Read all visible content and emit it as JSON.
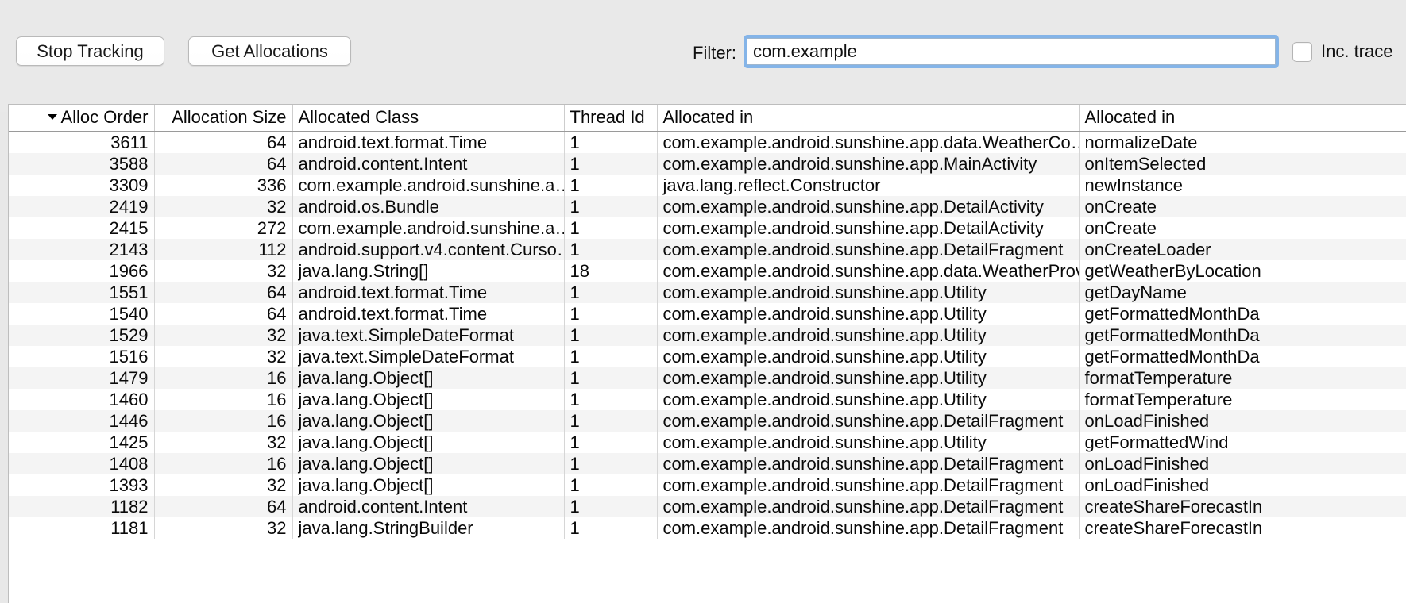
{
  "toolbar": {
    "stop_tracking_label": "Stop Tracking",
    "get_allocations_label": "Get Allocations",
    "filter_label": "Filter:",
    "filter_value": "com.example",
    "filter_placeholder": "",
    "inc_trace_label": "Inc. trace",
    "inc_trace_checked": false
  },
  "colors": {
    "focus_ring": "#84b4e8",
    "window_bg": "#e9e9e9",
    "row_alt": "#f4f4f4",
    "grid_line": "#d6d6d6"
  },
  "table": {
    "sort_column": "Alloc Order",
    "sort_direction": "descending",
    "columns": [
      {
        "key": "alloc_order",
        "label": "Alloc Order",
        "align": "right"
      },
      {
        "key": "allocation_size",
        "label": "Allocation Size",
        "align": "right"
      },
      {
        "key": "allocated_class",
        "label": "Allocated Class",
        "align": "left"
      },
      {
        "key": "thread_id",
        "label": "Thread Id",
        "align": "left"
      },
      {
        "key": "allocated_in_class",
        "label": "Allocated in",
        "align": "left"
      },
      {
        "key": "allocated_in_method",
        "label": "Allocated in",
        "align": "left"
      }
    ],
    "rows": [
      {
        "alloc_order": "3611",
        "allocation_size": "64",
        "allocated_class": "android.text.format.Time",
        "thread_id": "1",
        "allocated_in_class": "com.example.android.sunshine.app.data.WeatherCo…",
        "allocated_in_method": "normalizeDate"
      },
      {
        "alloc_order": "3588",
        "allocation_size": "64",
        "allocated_class": "android.content.Intent",
        "thread_id": "1",
        "allocated_in_class": "com.example.android.sunshine.app.MainActivity",
        "allocated_in_method": "onItemSelected"
      },
      {
        "alloc_order": "3309",
        "allocation_size": "336",
        "allocated_class": "com.example.android.sunshine.a…",
        "thread_id": "1",
        "allocated_in_class": "java.lang.reflect.Constructor",
        "allocated_in_method": "newInstance"
      },
      {
        "alloc_order": "2419",
        "allocation_size": "32",
        "allocated_class": "android.os.Bundle",
        "thread_id": "1",
        "allocated_in_class": "com.example.android.sunshine.app.DetailActivity",
        "allocated_in_method": "onCreate"
      },
      {
        "alloc_order": "2415",
        "allocation_size": "272",
        "allocated_class": "com.example.android.sunshine.a…",
        "thread_id": "1",
        "allocated_in_class": "com.example.android.sunshine.app.DetailActivity",
        "allocated_in_method": "onCreate"
      },
      {
        "alloc_order": "2143",
        "allocation_size": "112",
        "allocated_class": "android.support.v4.content.Curso…",
        "thread_id": "1",
        "allocated_in_class": "com.example.android.sunshine.app.DetailFragment",
        "allocated_in_method": "onCreateLoader"
      },
      {
        "alloc_order": "1966",
        "allocation_size": "32",
        "allocated_class": "java.lang.String[]",
        "thread_id": "18",
        "allocated_in_class": "com.example.android.sunshine.app.data.WeatherProvider",
        "allocated_in_method": "getWeatherByLocation"
      },
      {
        "alloc_order": "1551",
        "allocation_size": "64",
        "allocated_class": "android.text.format.Time",
        "thread_id": "1",
        "allocated_in_class": "com.example.android.sunshine.app.Utility",
        "allocated_in_method": "getDayName"
      },
      {
        "alloc_order": "1540",
        "allocation_size": "64",
        "allocated_class": "android.text.format.Time",
        "thread_id": "1",
        "allocated_in_class": "com.example.android.sunshine.app.Utility",
        "allocated_in_method": "getFormattedMonthDa"
      },
      {
        "alloc_order": "1529",
        "allocation_size": "32",
        "allocated_class": "java.text.SimpleDateFormat",
        "thread_id": "1",
        "allocated_in_class": "com.example.android.sunshine.app.Utility",
        "allocated_in_method": "getFormattedMonthDa"
      },
      {
        "alloc_order": "1516",
        "allocation_size": "32",
        "allocated_class": "java.text.SimpleDateFormat",
        "thread_id": "1",
        "allocated_in_class": "com.example.android.sunshine.app.Utility",
        "allocated_in_method": "getFormattedMonthDa"
      },
      {
        "alloc_order": "1479",
        "allocation_size": "16",
        "allocated_class": "java.lang.Object[]",
        "thread_id": "1",
        "allocated_in_class": "com.example.android.sunshine.app.Utility",
        "allocated_in_method": "formatTemperature"
      },
      {
        "alloc_order": "1460",
        "allocation_size": "16",
        "allocated_class": "java.lang.Object[]",
        "thread_id": "1",
        "allocated_in_class": "com.example.android.sunshine.app.Utility",
        "allocated_in_method": "formatTemperature"
      },
      {
        "alloc_order": "1446",
        "allocation_size": "16",
        "allocated_class": "java.lang.Object[]",
        "thread_id": "1",
        "allocated_in_class": "com.example.android.sunshine.app.DetailFragment",
        "allocated_in_method": "onLoadFinished"
      },
      {
        "alloc_order": "1425",
        "allocation_size": "32",
        "allocated_class": "java.lang.Object[]",
        "thread_id": "1",
        "allocated_in_class": "com.example.android.sunshine.app.Utility",
        "allocated_in_method": "getFormattedWind"
      },
      {
        "alloc_order": "1408",
        "allocation_size": "16",
        "allocated_class": "java.lang.Object[]",
        "thread_id": "1",
        "allocated_in_class": "com.example.android.sunshine.app.DetailFragment",
        "allocated_in_method": "onLoadFinished"
      },
      {
        "alloc_order": "1393",
        "allocation_size": "32",
        "allocated_class": "java.lang.Object[]",
        "thread_id": "1",
        "allocated_in_class": "com.example.android.sunshine.app.DetailFragment",
        "allocated_in_method": "onLoadFinished"
      },
      {
        "alloc_order": "1182",
        "allocation_size": "64",
        "allocated_class": "android.content.Intent",
        "thread_id": "1",
        "allocated_in_class": "com.example.android.sunshine.app.DetailFragment",
        "allocated_in_method": "createShareForecastIn"
      },
      {
        "alloc_order": "1181",
        "allocation_size": "32",
        "allocated_class": "java.lang.StringBuilder",
        "thread_id": "1",
        "allocated_in_class": "com.example.android.sunshine.app.DetailFragment",
        "allocated_in_method": "createShareForecastIn"
      }
    ]
  }
}
